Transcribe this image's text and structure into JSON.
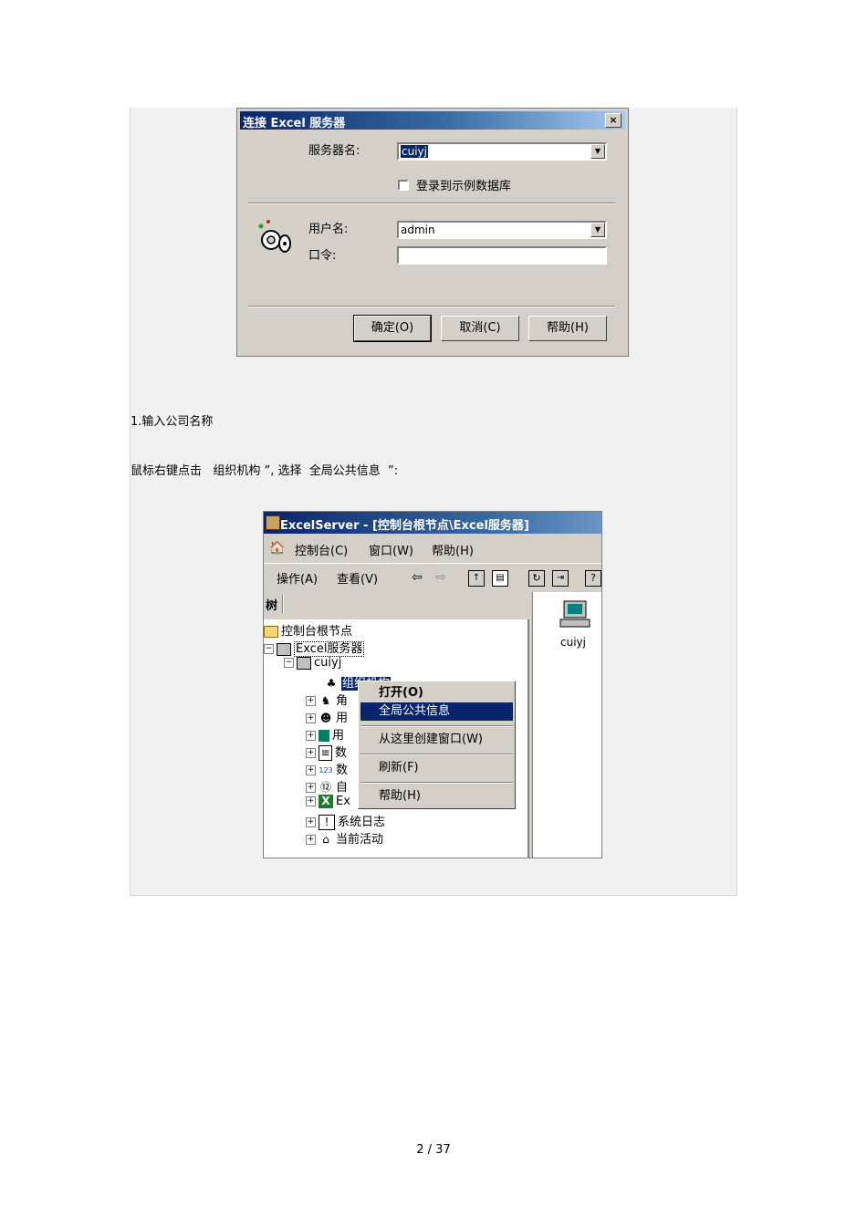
{
  "dialog": {
    "title": "连接 Excel 服务器",
    "close_label": "×",
    "server_label": "服务器名:",
    "server_value": "cuiyj",
    "sample_db_label": "登录到示例数据库",
    "user_label": "用户名:",
    "user_value": "admin",
    "password_label": "口令:",
    "password_value": "",
    "ok_button": "确定(O)",
    "cancel_button": "取消(C)",
    "help_button": "帮助(H)"
  },
  "text": {
    "step1": "1.输入公司名称",
    "instruction": "鼠标右键点击   组织机构 ”, 选择  全局公共信息  ”:"
  },
  "mmc": {
    "title": "ExcelServer - [控制台根节点\\Excel服务器]",
    "menu": [
      "控制台(C)",
      "窗口(W)",
      "帮助(H)"
    ],
    "toolbar": [
      "操作(A)",
      "查看(V)"
    ],
    "tree_header": "树",
    "tree": {
      "root": "控制台根节点",
      "server": "Excel服务器",
      "host": "cuiyj",
      "children": [
        "组织机构",
        "角",
        "用",
        "用",
        "数",
        "数",
        "自",
        "Ex",
        "系统日志",
        "当前活动"
      ]
    },
    "right_item": "cuiyj",
    "context_menu": [
      "打开(O)",
      "全局公共信息",
      "从这里创建窗口(W)",
      "刷新(F)",
      "帮助(H)"
    ]
  },
  "page_number": "2 / 37"
}
